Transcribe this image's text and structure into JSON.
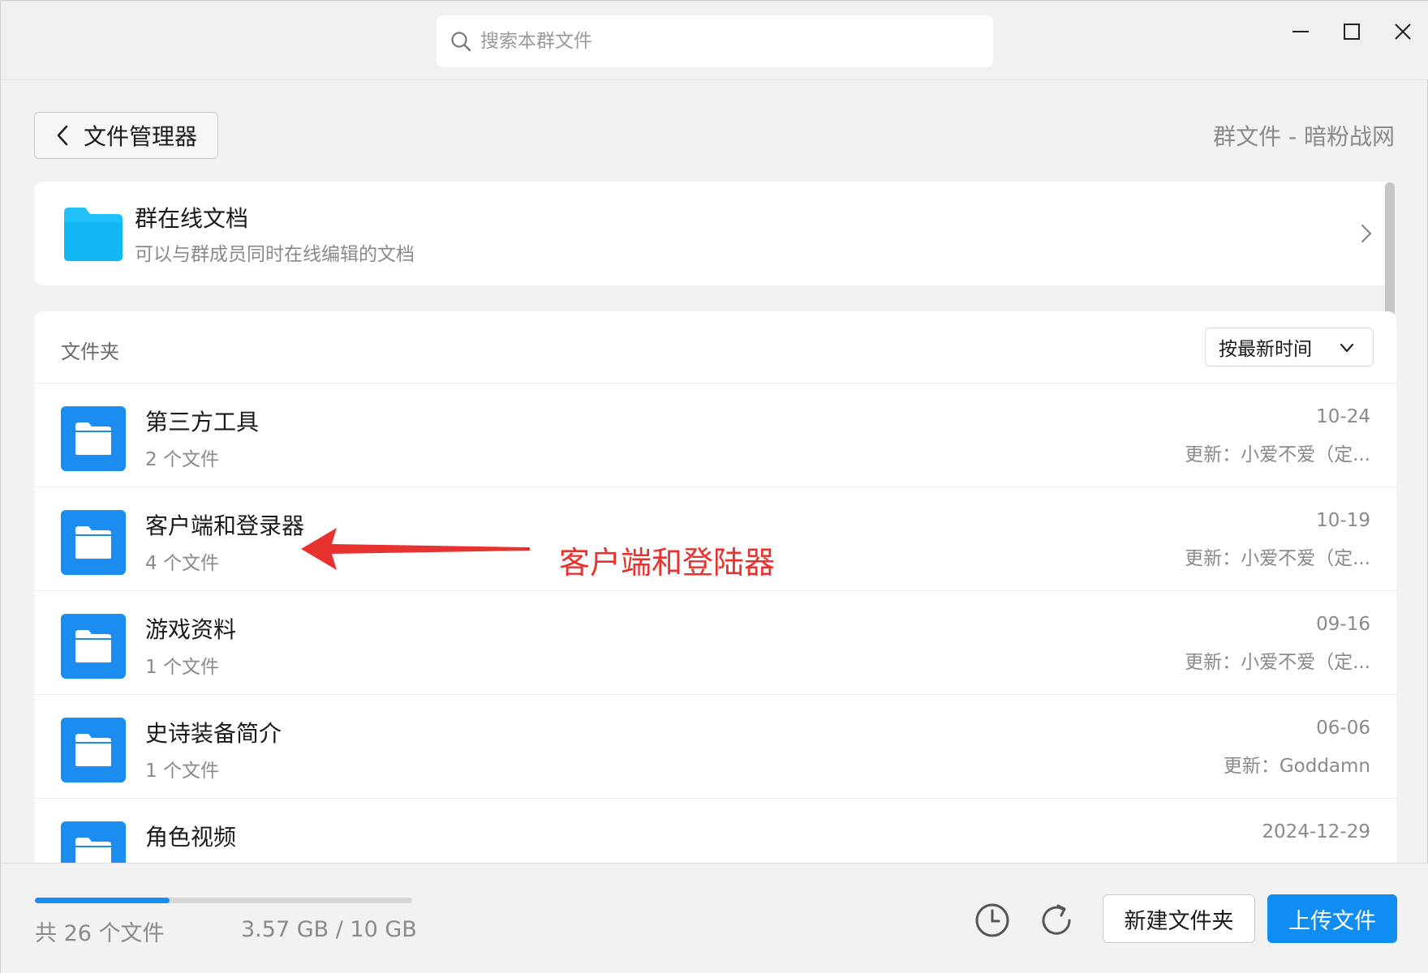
{
  "search": {
    "placeholder": "搜索本群文件"
  },
  "header": {
    "back_label": "文件管理器",
    "group_title": "群文件 - 暗粉战网"
  },
  "online_docs": {
    "title": "群在线文档",
    "subtitle": "可以与群成员同时在线编辑的文档"
  },
  "folders_section": {
    "label": "文件夹",
    "sort_label": "按最新时间"
  },
  "folders": [
    {
      "name": "第三方工具",
      "count": "2 个文件",
      "date": "10-24",
      "updater": "更新：小爱不爱（定..."
    },
    {
      "name": "客户端和登录器",
      "count": "4 个文件",
      "date": "10-19",
      "updater": "更新：小爱不爱（定..."
    },
    {
      "name": "游戏资料",
      "count": "1 个文件",
      "date": "09-16",
      "updater": "更新：小爱不爱（定..."
    },
    {
      "name": "史诗装备简介",
      "count": "1 个文件",
      "date": "06-06",
      "updater": "更新：Goddamn"
    },
    {
      "name": "角色视频",
      "count": "",
      "date": "2024-12-29",
      "updater": ""
    }
  ],
  "annotation": {
    "text": "客户端和登陆器",
    "color": "#e8322f"
  },
  "footer": {
    "file_count": "共 26 个文件",
    "storage": "3.57 GB / 10 GB",
    "storage_used_fraction": 0.357,
    "new_folder_label": "新建文件夹",
    "upload_label": "上传文件"
  },
  "colors": {
    "accent": "#1a8cf2",
    "online_doc_folder": "#1ec0f7"
  },
  "icons": [
    "search-icon",
    "minimize-icon",
    "maximize-icon",
    "close-icon",
    "chevron-left-icon",
    "chevron-right-icon",
    "chevron-down-icon",
    "folder-icon",
    "history-icon",
    "refresh-icon"
  ]
}
